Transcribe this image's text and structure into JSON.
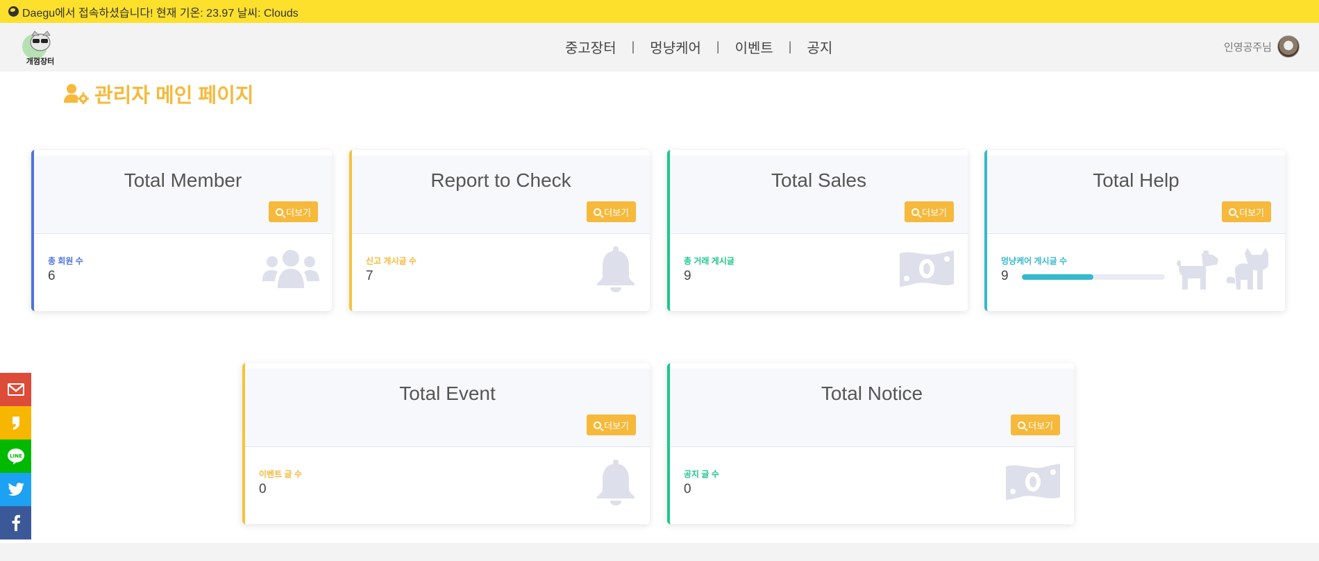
{
  "weather": {
    "text": "Daegu에서 접속하셨습니다! 현재 기온: 23.97 날씨: Clouds"
  },
  "logo": {
    "text": "개껌장터"
  },
  "nav": {
    "items": [
      "중고장터",
      "멍냥케어",
      "이벤트",
      "공지"
    ],
    "separator": "|"
  },
  "user": {
    "name": "인영공주님"
  },
  "page": {
    "title": "관리자 메인 페이지"
  },
  "cards": [
    {
      "title": "Total Member",
      "button": "더보기",
      "label": "총 회원 수",
      "value": "6",
      "icon": "users-icon"
    },
    {
      "title": "Report to Check",
      "button": "더보기",
      "label": "신고 게시글 수",
      "value": "7",
      "icon": "bell-icon"
    },
    {
      "title": "Total Sales",
      "button": "더보기",
      "label": "총 거래 게시글",
      "value": "9",
      "icon": "money-bill-icon"
    },
    {
      "title": "Total Help",
      "button": "더보기",
      "label": "멍냥케어 게시글 수",
      "value": "9",
      "icon": "dog-cat-icon",
      "progress": 0.5
    },
    {
      "title": "Total Event",
      "button": "더보기",
      "label": "이벤트 글 수",
      "value": "0",
      "icon": "bell-icon"
    },
    {
      "title": "Total Notice",
      "button": "더보기",
      "label": "공지 글 수",
      "value": "0",
      "icon": "money-bill-icon"
    }
  ],
  "share": [
    {
      "icon": "gmail-icon",
      "color": "#dd4b39"
    },
    {
      "icon": "kakao-icon",
      "color": "#f7b600"
    },
    {
      "icon": "line-icon",
      "color": "#00b900",
      "text": "LINE"
    },
    {
      "icon": "twitter-icon",
      "color": "#1da1f2"
    },
    {
      "icon": "facebook-icon",
      "color": "#3b5998"
    }
  ],
  "colors": {
    "accent": "#f6b93b",
    "weather_bar": "#fde02b",
    "primary": "#4e73df",
    "warning": "#f6c23e",
    "success": "#1cc88a",
    "info": "#36b9cc"
  }
}
